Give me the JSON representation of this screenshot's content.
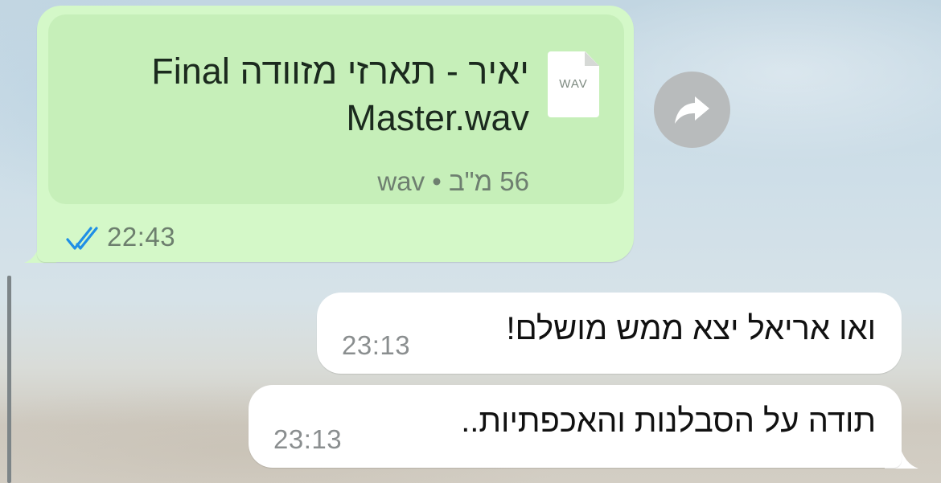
{
  "outgoing_message": {
    "file_name": "יאיר - תארזי מזוודה Final Master.wav",
    "file_icon_label": "WAV",
    "file_size": "56 מ\"ב",
    "separator": "•",
    "file_ext": "wav",
    "time": "22:43",
    "status": "read",
    "tick_color": "#1f8fe6",
    "bubble_color": "#d4f8c8"
  },
  "forward_button": {
    "icon": "forward-arrow-icon"
  },
  "incoming_messages": [
    {
      "text": "ואו אריאל יצא ממש מושלם!",
      "time": "23:13"
    },
    {
      "text": "תודה על הסבלנות והאכפתיות..",
      "time": "23:13"
    }
  ]
}
